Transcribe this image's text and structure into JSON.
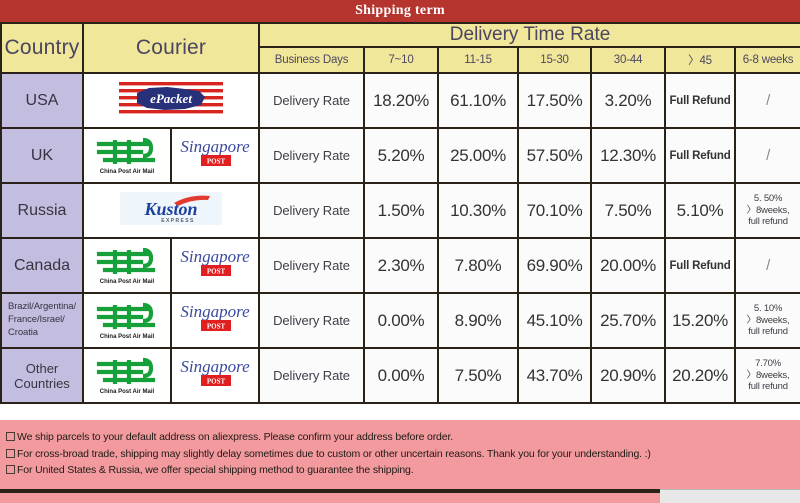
{
  "title": "Shipping term",
  "header": {
    "country": "Country",
    "courier": "Courier",
    "delivery_time_rate": "Delivery Time Rate",
    "columns": [
      "Business Days",
      "7~10",
      "11-15",
      "15-30",
      "30-44",
      "〉45",
      "6-8 weeks"
    ]
  },
  "colors": {
    "title_bar": "#b5342e",
    "header_yellow": "#f0e79a",
    "country_purple": "#c3bde0",
    "notes_pink": "#f29a9e",
    "border": "#2a2118"
  },
  "rows": [
    {
      "country": "USA",
      "couriers": [
        "epacket-logo"
      ],
      "rate_label": "Delivery Rate",
      "values": [
        "18.20%",
        "61.10%",
        "17.50%",
        "3.20%",
        "Full Refund",
        "/"
      ]
    },
    {
      "country": "UK",
      "couriers": [
        "china-post-air-mail-logo",
        "singapore-post-logo"
      ],
      "rate_label": "Delivery Rate",
      "values": [
        "5.20%",
        "25.00%",
        "57.50%",
        "12.30%",
        "Full Refund",
        "/"
      ]
    },
    {
      "country": "Russia",
      "couriers": [
        "kuston-express-logo"
      ],
      "rate_label": "Delivery Rate",
      "values": [
        "1.50%",
        "10.30%",
        "70.10%",
        "7.50%",
        "5.10%",
        "5. 50%\n〉8weeks,\nfull refund"
      ]
    },
    {
      "country": "Canada",
      "couriers": [
        "china-post-air-mail-logo",
        "singapore-post-logo"
      ],
      "rate_label": "Delivery Rate",
      "values": [
        "2.30%",
        "7.80%",
        "69.90%",
        "20.00%",
        "Full Refund",
        "/"
      ]
    },
    {
      "country": "Brazil/Argentina/\nFrance/Israel/\nCroatia",
      "couriers": [
        "china-post-air-mail-logo",
        "singapore-post-logo"
      ],
      "rate_label": "Delivery Rate",
      "values": [
        "0.00%",
        "8.90%",
        "45.10%",
        "25.70%",
        "15.20%",
        "5. 10%\n〉8weeks,\nfull refund"
      ]
    },
    {
      "country": "Other Countries",
      "couriers": [
        "china-post-air-mail-logo",
        "singapore-post-logo"
      ],
      "rate_label": "Delivery Rate",
      "values": [
        "0.00%",
        "7.50%",
        "43.70%",
        "20.90%",
        "20.20%",
        "7.70%\n〉8weeks,\nfull refund"
      ]
    }
  ],
  "notes": [
    "We ship parcels to your default address on aliexpress. Please confirm your address before order.",
    "For cross-broad trade, shipping may slightly delay sometimes due to custom or other uncertain reasons. Thank you for your understanding. :)",
    "For United States & Russia, we offer special shipping method to guarantee the shipping."
  ],
  "logo_text": {
    "epacket": "ePacket",
    "china_post": "China Post Air Mail",
    "singapore_post_top": "Singapore",
    "singapore_post_bottom": "POST",
    "kuston": "Kuston",
    "kuston_sub": "EXPRESS"
  }
}
